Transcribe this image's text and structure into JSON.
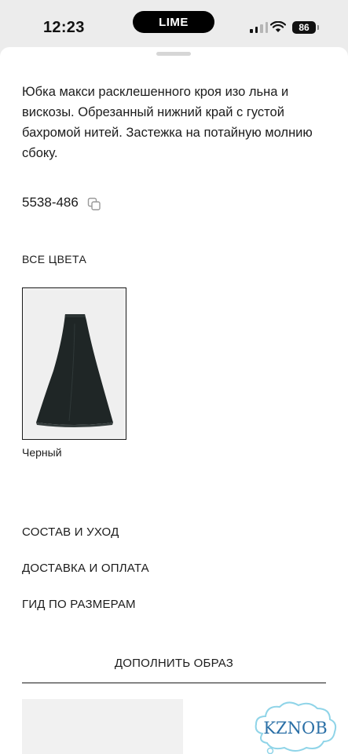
{
  "status_bar": {
    "time": "12:23",
    "island_label": "LIME",
    "battery": "86"
  },
  "product": {
    "description": "Юбка макси расклешенного кроя изо льна и вискозы. Обрезанный нижний край с густой бахромой нитей. Застежка на потайную молнию сбоку.",
    "reference": "5538-486",
    "copy_icon": "copy-icon"
  },
  "colors": {
    "heading": "ВСЕ ЦВЕТА",
    "swatches": [
      {
        "label": "Черный",
        "color": "#1f2626"
      }
    ]
  },
  "accordion": {
    "composition": "СОСТАВ И УХОД",
    "delivery": "ДОСТАВКА И ОПЛАТА",
    "size_guide": "ГИД ПО РАЗМЕРАМ"
  },
  "complete_look": {
    "label": "ДОПОЛНИТЬ ОБРАЗ"
  },
  "watermark": {
    "text": "KZNOB"
  }
}
